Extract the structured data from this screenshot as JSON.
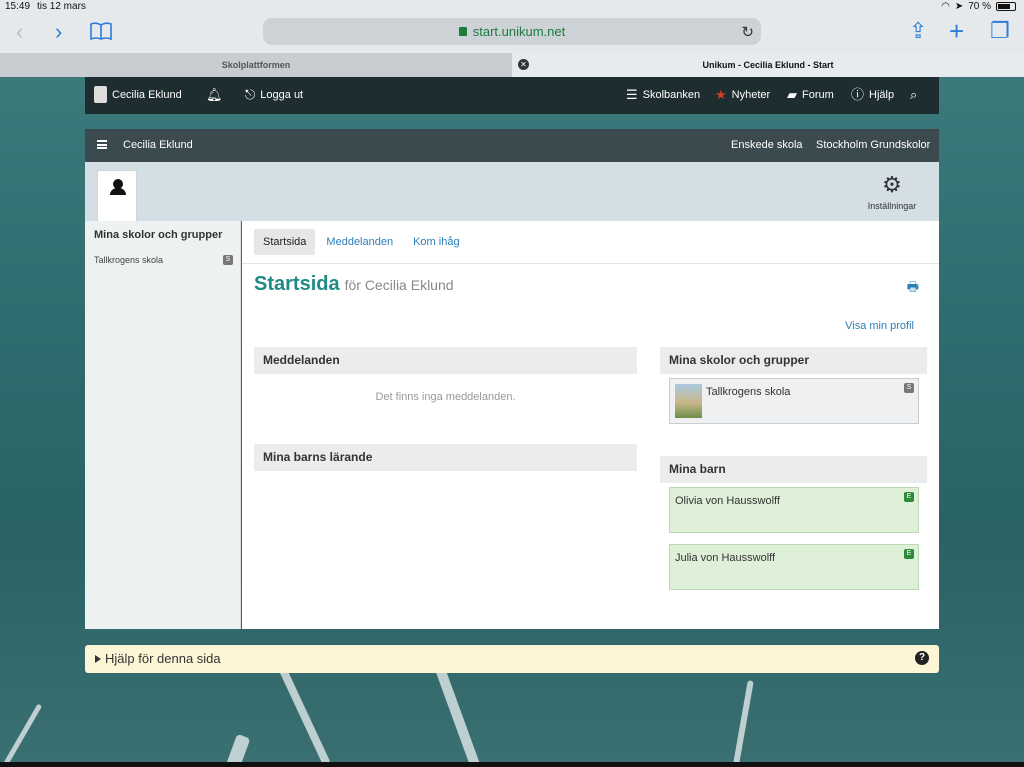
{
  "status": {
    "time": "15:49",
    "date": "tis 12 mars",
    "battery": "70 %"
  },
  "browser": {
    "url": "start.unikum.net",
    "tabs": [
      {
        "label": "Skolplattformen"
      },
      {
        "label": "Unikum - Cecilia Eklund - Start"
      }
    ]
  },
  "topnav": {
    "user": "Cecilia Eklund",
    "logout": "Logga ut",
    "items": [
      {
        "label": "Skolbanken"
      },
      {
        "label": "Nyheter"
      },
      {
        "label": "Forum"
      },
      {
        "label": "Hjälp"
      }
    ]
  },
  "header": {
    "name": "Cecilia Eklund",
    "school": "Enskede skola",
    "org": "Stockholm Grundskolor",
    "settings": "Inställningar"
  },
  "sidebar": {
    "title": "Mina skolor och grupper",
    "items": [
      {
        "label": "Tallkrogens skola",
        "badge": "S"
      }
    ]
  },
  "main": {
    "tabs": [
      {
        "label": "Startsida"
      },
      {
        "label": "Meddelanden"
      },
      {
        "label": "Kom ihåg"
      }
    ],
    "title": "Startsida",
    "subtitle": "för Cecilia Eklund",
    "profile_link": "Visa min profil",
    "messages": {
      "title": "Meddelanden",
      "empty": "Det finns inga meddelanden."
    },
    "learning": {
      "title": "Mina barns lärande"
    },
    "schools": {
      "title": "Mina skolor och grupper",
      "items": [
        {
          "name": "Tallkrogens skola",
          "badge": "S"
        }
      ]
    },
    "children": {
      "title": "Mina barn",
      "items": [
        {
          "name": "Olivia von Hausswolff",
          "badge": "E"
        },
        {
          "name": "Julia von Hausswolff",
          "badge": "E"
        }
      ]
    }
  },
  "help": {
    "label": "Hjälp för denna sida"
  }
}
